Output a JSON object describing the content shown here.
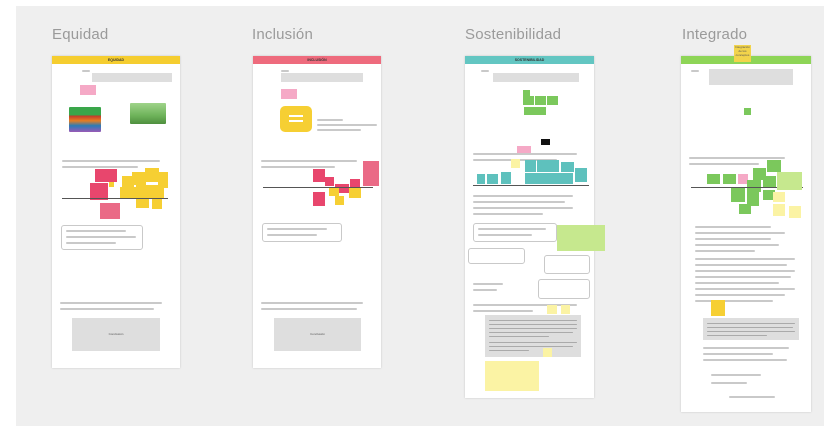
{
  "columns": [
    {
      "title": "Equidad",
      "frame_header": "EQUIDAD",
      "header_color": "#f5cd2f",
      "bottom_box_label": "Conclusión"
    },
    {
      "title": "Inclusión",
      "frame_header": "INCLUSIÓN",
      "header_color": "#ee6b7d",
      "bottom_box_label": "Conclusión"
    },
    {
      "title": "Sostenibilidad",
      "frame_header": "SOSTENIBILIDAD",
      "header_color": "#63c6c2"
    },
    {
      "title": "Integrado",
      "header_color": "#8ed557",
      "sticky_note": "Integración de los conceptos"
    }
  ],
  "icons": {
    "chat": "speech-bubble-icon"
  },
  "colors": {
    "board": "#efefef",
    "title_text": "#9a9a9a"
  }
}
